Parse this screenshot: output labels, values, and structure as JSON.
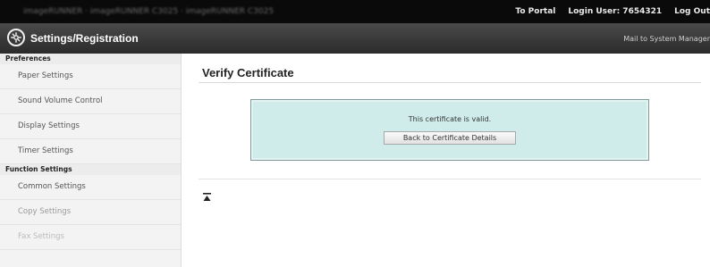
{
  "topbar": {
    "breadcrumb": "imageRUNNER · imageRUNNER C3025 · imageRUNNER C3025",
    "to_portal": "To Portal",
    "login_user": "Login User: 7654321",
    "log_out": "Log Out"
  },
  "header": {
    "title": "Settings/Registration",
    "mail_link": "Mail to System Manager",
    "logo_icon": "settings-gear-icon"
  },
  "sidebar": {
    "sections": [
      {
        "label": "Preferences",
        "items": [
          "Paper Settings",
          "Sound Volume Control",
          "Display Settings",
          "Timer Settings"
        ]
      },
      {
        "label": "Function Settings",
        "items": [
          "Common Settings",
          "Copy Settings",
          "Fax Settings"
        ]
      }
    ]
  },
  "main": {
    "title": "Verify Certificate",
    "message": "This certificate is valid.",
    "back_button": "Back to Certificate Details",
    "top_icon": "scroll-to-top-icon"
  },
  "colors": {
    "topbar_bg": "#0a0a0a",
    "header_bg": "#333333",
    "message_box_bg": "#cfecea",
    "sidebar_bg": "#f3f3f3"
  }
}
